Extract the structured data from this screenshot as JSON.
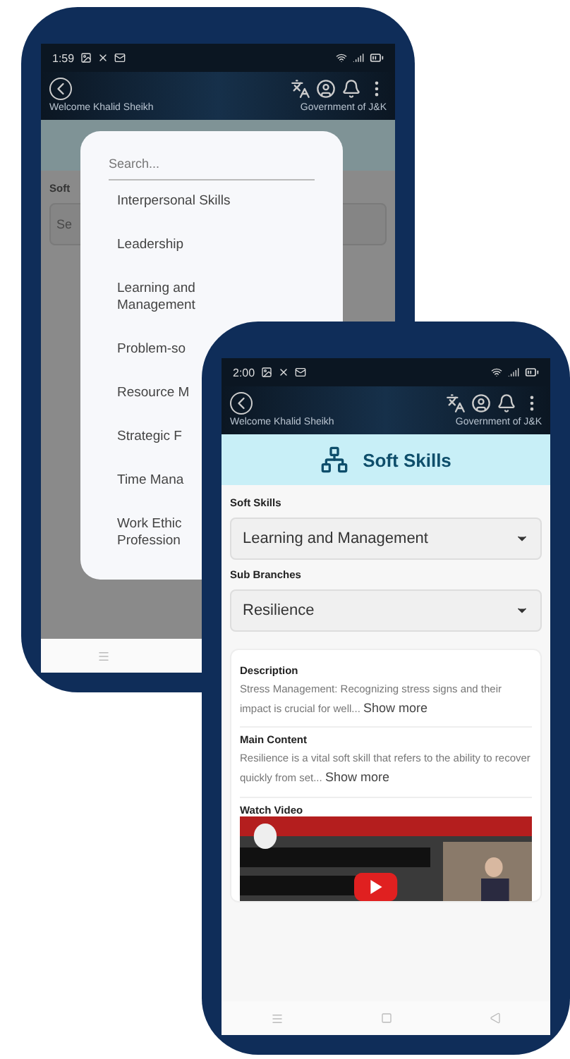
{
  "back_phone": {
    "time": "1:59",
    "header": {
      "welcome": "Welcome Khalid Sheikh",
      "org": "Government of J&K"
    },
    "form": {
      "label": "Soft",
      "placeholder": "Se"
    },
    "dropdown": {
      "search_placeholder": "Search...",
      "options": [
        {
          "label": "Interpersonal Skills"
        },
        {
          "label": "Leadership"
        },
        {
          "label": "Learning and\nManagement"
        },
        {
          "label": "Problem-so"
        },
        {
          "label": "Resource M"
        },
        {
          "label": "Strategic F"
        },
        {
          "label": "Time Mana"
        },
        {
          "label": "Work Ethic\nProfession"
        }
      ]
    }
  },
  "front_phone": {
    "time": "2:00",
    "header": {
      "welcome": "Welcome Khalid Sheikh",
      "org": "Government of J&K"
    },
    "page_title": "Soft Skills",
    "fields": [
      {
        "label": "Soft Skills",
        "value": "Learning and Management"
      },
      {
        "label": "Sub Branches",
        "value": "Resilience"
      }
    ],
    "sections": [
      {
        "label": "Description",
        "text": "Stress Management: Recognizing stress signs and their impact is crucial for well...",
        "link": "Show more"
      },
      {
        "label": "Main Content",
        "text": "Resilience is a vital soft skill that refers to the ability to recover quickly from set...",
        "link": "Show more"
      }
    ],
    "video": {
      "label": "Watch Video",
      "kind": "picture"
    }
  }
}
